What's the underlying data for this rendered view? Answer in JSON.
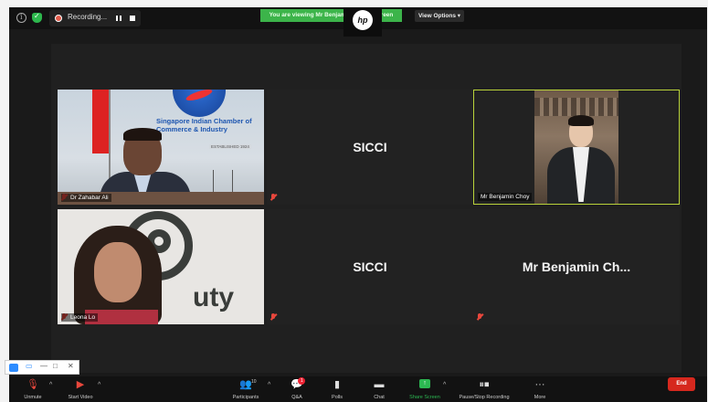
{
  "topbar": {
    "recording_label": "Recording...",
    "viewing_banner": "You are viewing Mr Benjamin Choy's screen",
    "view_options": "View Options ▾",
    "hp_logo": "hp"
  },
  "tiles": [
    {
      "type": "video",
      "name": "Dr Zahabar Ali",
      "chamber_text": "Singapore Indian Chamber of Commerce & Industry",
      "chamber_sub": "ESTABLISHED 1924"
    },
    {
      "type": "text",
      "display": "SICCI"
    },
    {
      "type": "video",
      "name": "Mr Benjamin Choy",
      "active": true
    },
    {
      "type": "video",
      "name": "Leona Lo",
      "logo_text": "uty"
    },
    {
      "type": "text",
      "display": "SICCI"
    },
    {
      "type": "text",
      "display": "Mr Benjamin Ch..."
    }
  ],
  "toolbar": {
    "unmute": "Unmute",
    "start_video": "Start Video",
    "participants": "Participants",
    "participants_count": "10",
    "qa": "Q&A",
    "qa_badge": "1",
    "polls": "Polls",
    "chat": "Chat",
    "share_screen": "Share Screen",
    "pause_stop": "Pause/Stop Recording",
    "more": "More",
    "end": "End"
  },
  "colors": {
    "active_speaker_border": "#b9d23a",
    "share_green": "#2cb852",
    "end_red": "#d6281e",
    "banner_green": "#3cb44a"
  }
}
